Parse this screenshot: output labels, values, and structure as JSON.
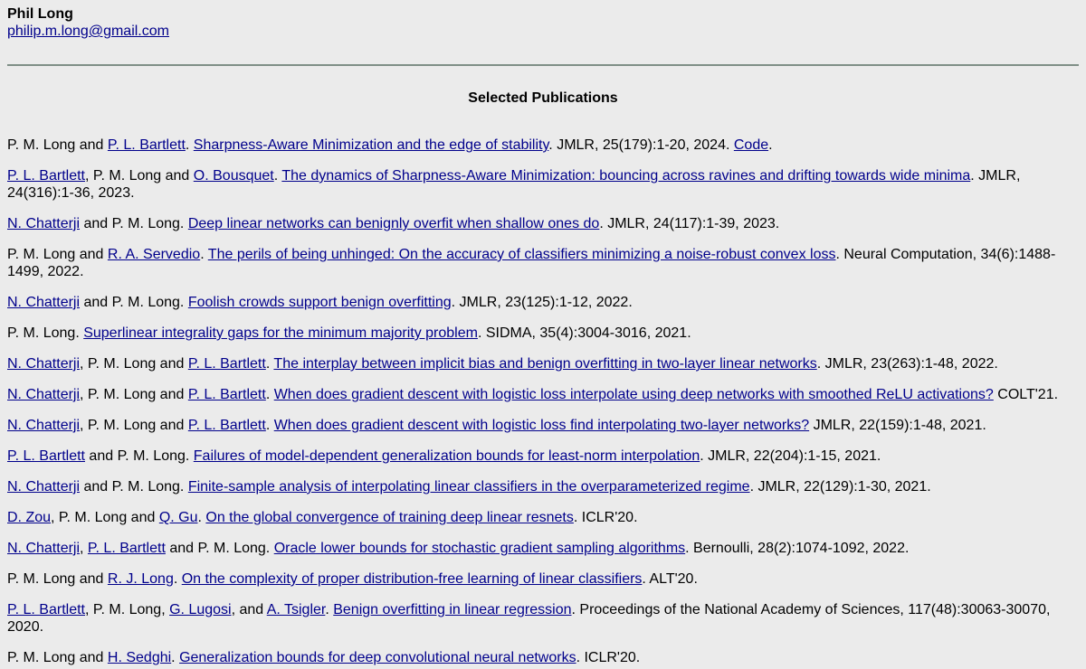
{
  "header": {
    "name": "Phil Long",
    "email": "philip.m.long@gmail.com"
  },
  "section_title": "Selected Publications",
  "publications": [
    [
      {
        "t": "P. M. Long and "
      },
      {
        "t": "P. L. Bartlett",
        "link": true
      },
      {
        "t": ". "
      },
      {
        "t": "Sharpness-Aware Minimization and the edge of stability",
        "link": true
      },
      {
        "t": ". JMLR, 25(179):1-20, 2024. "
      },
      {
        "t": "Code",
        "link": true
      },
      {
        "t": "."
      }
    ],
    [
      {
        "t": "P. L. Bartlett",
        "link": true
      },
      {
        "t": ", P. M. Long and "
      },
      {
        "t": "O. Bousquet",
        "link": true
      },
      {
        "t": ". "
      },
      {
        "t": "The dynamics of Sharpness-Aware Minimization: bouncing across ravines and drifting towards wide minima",
        "link": true
      },
      {
        "t": ". JMLR, 24(316):1-36, 2023."
      }
    ],
    [
      {
        "t": "N. Chatterji",
        "link": true
      },
      {
        "t": " and P. M. Long. "
      },
      {
        "t": "Deep linear networks can benignly overfit when shallow ones do",
        "link": true
      },
      {
        "t": ". JMLR, 24(117):1-39, 2023."
      }
    ],
    [
      {
        "t": "P. M. Long and "
      },
      {
        "t": "R. A. Servedio",
        "link": true
      },
      {
        "t": ". "
      },
      {
        "t": "The perils of being unhinged: On the accuracy of classifiers minimizing a noise-robust convex loss",
        "link": true
      },
      {
        "t": ". Neural Computation, 34(6):1488-1499, 2022."
      }
    ],
    [
      {
        "t": "N. Chatterji",
        "link": true
      },
      {
        "t": " and P. M. Long. "
      },
      {
        "t": "Foolish crowds support benign overfitting",
        "link": true
      },
      {
        "t": ". JMLR, 23(125):1-12, 2022."
      }
    ],
    [
      {
        "t": "P. M. Long. "
      },
      {
        "t": "Superlinear integrality gaps for the minimum majority problem",
        "link": true
      },
      {
        "t": ". SIDMA, 35(4):3004-3016, 2021."
      }
    ],
    [
      {
        "t": "N. Chatterji",
        "link": true
      },
      {
        "t": ", P. M. Long and "
      },
      {
        "t": "P. L. Bartlett",
        "link": true
      },
      {
        "t": ". "
      },
      {
        "t": "The interplay between implicit bias and benign overfitting in two-layer linear networks",
        "link": true
      },
      {
        "t": ". JMLR, 23(263):1-48, 2022."
      }
    ],
    [
      {
        "t": "N. Chatterji",
        "link": true
      },
      {
        "t": ", P. M. Long and "
      },
      {
        "t": "P. L. Bartlett",
        "link": true
      },
      {
        "t": ". "
      },
      {
        "t": "When does gradient descent with logistic loss interpolate using deep networks with smoothed ReLU activations?",
        "link": true
      },
      {
        "t": " COLT'21."
      }
    ],
    [
      {
        "t": "N. Chatterji",
        "link": true
      },
      {
        "t": ", P. M. Long and "
      },
      {
        "t": "P. L. Bartlett",
        "link": true
      },
      {
        "t": ". "
      },
      {
        "t": "When does gradient descent with logistic loss find interpolating two-layer networks?",
        "link": true
      },
      {
        "t": " JMLR, 22(159):1-48, 2021."
      }
    ],
    [
      {
        "t": "P. L. Bartlett",
        "link": true
      },
      {
        "t": " and P. M. Long. "
      },
      {
        "t": "Failures of model-dependent generalization bounds for least-norm interpolation",
        "link": true
      },
      {
        "t": ". JMLR, 22(204):1-15, 2021."
      }
    ],
    [
      {
        "t": "N. Chatterji",
        "link": true
      },
      {
        "t": " and P. M. Long. "
      },
      {
        "t": "Finite-sample analysis of interpolating linear classifiers in the overparameterized regime",
        "link": true
      },
      {
        "t": ". JMLR, 22(129):1-30, 2021."
      }
    ],
    [
      {
        "t": "D. Zou",
        "link": true
      },
      {
        "t": ", P. M. Long and "
      },
      {
        "t": "Q. Gu",
        "link": true
      },
      {
        "t": ". "
      },
      {
        "t": "On the global convergence of training deep linear resnets",
        "link": true
      },
      {
        "t": ". ICLR'20."
      }
    ],
    [
      {
        "t": "N. Chatterji",
        "link": true
      },
      {
        "t": ", "
      },
      {
        "t": "P. L. Bartlett",
        "link": true
      },
      {
        "t": " and P. M. Long. "
      },
      {
        "t": "Oracle lower bounds for stochastic gradient sampling algorithms",
        "link": true
      },
      {
        "t": ". Bernoulli, 28(2):1074-1092, 2022."
      }
    ],
    [
      {
        "t": "P. M. Long and "
      },
      {
        "t": "R. J. Long",
        "link": true
      },
      {
        "t": ". "
      },
      {
        "t": "On the complexity of proper distribution-free learning of linear classifiers",
        "link": true
      },
      {
        "t": ". ALT'20."
      }
    ],
    [
      {
        "t": "P. L. Bartlett",
        "link": true
      },
      {
        "t": ", P. M. Long, "
      },
      {
        "t": "G. Lugosi",
        "link": true
      },
      {
        "t": ", and "
      },
      {
        "t": "A. Tsigler",
        "link": true
      },
      {
        "t": ". "
      },
      {
        "t": "Benign overfitting in linear regression",
        "link": true
      },
      {
        "t": ". Proceedings of the National Academy of Sciences, 117(48):30063-30070, 2020."
      }
    ],
    [
      {
        "t": "P. M. Long and "
      },
      {
        "t": "H. Sedghi",
        "link": true
      },
      {
        "t": ". "
      },
      {
        "t": "Generalization bounds for deep convolutional neural networks",
        "link": true
      },
      {
        "t": ". ICLR'20."
      }
    ]
  ]
}
